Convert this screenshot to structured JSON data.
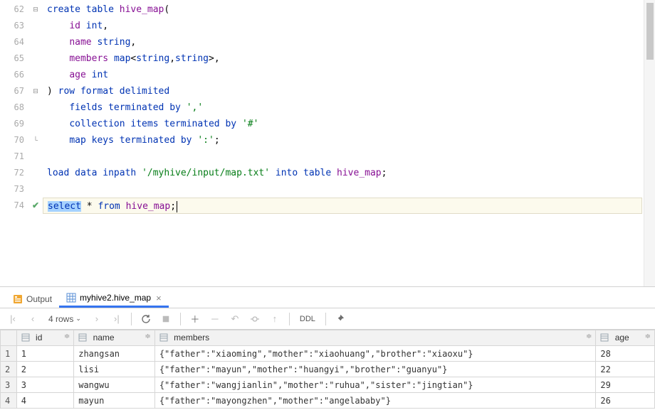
{
  "editor": {
    "lines": [
      {
        "n": 62,
        "fold": "open",
        "tokens": [
          [
            "kw",
            "create table"
          ],
          [
            "plain",
            " "
          ],
          [
            "ident",
            "hive_map"
          ],
          [
            "plain",
            "("
          ]
        ]
      },
      {
        "n": 63,
        "tokens": [
          [
            "plain",
            "    "
          ],
          [
            "ident",
            "id"
          ],
          [
            "plain",
            " "
          ],
          [
            "typ",
            "int"
          ],
          [
            "plain",
            ","
          ]
        ]
      },
      {
        "n": 64,
        "tokens": [
          [
            "plain",
            "    "
          ],
          [
            "ident",
            "name"
          ],
          [
            "plain",
            " "
          ],
          [
            "typ",
            "string"
          ],
          [
            "plain",
            ","
          ]
        ]
      },
      {
        "n": 65,
        "tokens": [
          [
            "plain",
            "    "
          ],
          [
            "ident",
            "members"
          ],
          [
            "plain",
            " "
          ],
          [
            "typ",
            "map"
          ],
          [
            "plain",
            "<"
          ],
          [
            "typ",
            "string"
          ],
          [
            "plain",
            ","
          ],
          [
            "typ",
            "string"
          ],
          [
            "plain",
            ">,"
          ]
        ]
      },
      {
        "n": 66,
        "tokens": [
          [
            "plain",
            "    "
          ],
          [
            "ident",
            "age"
          ],
          [
            "plain",
            " "
          ],
          [
            "typ",
            "int"
          ]
        ]
      },
      {
        "n": 67,
        "fold": "close",
        "tokens": [
          [
            "plain",
            ") "
          ],
          [
            "kw",
            "row format delimited"
          ]
        ]
      },
      {
        "n": 68,
        "tokens": [
          [
            "plain",
            "    "
          ],
          [
            "kw",
            "fields terminated by"
          ],
          [
            "plain",
            " "
          ],
          [
            "str",
            "','"
          ]
        ]
      },
      {
        "n": 69,
        "tokens": [
          [
            "plain",
            "    "
          ],
          [
            "kw",
            "collection items terminated by"
          ],
          [
            "plain",
            " "
          ],
          [
            "str",
            "'#'"
          ]
        ]
      },
      {
        "n": 70,
        "fold": "end",
        "tokens": [
          [
            "plain",
            "    "
          ],
          [
            "kw",
            "map keys terminated by"
          ],
          [
            "plain",
            " "
          ],
          [
            "str",
            "':'"
          ],
          [
            "plain",
            ";"
          ]
        ]
      },
      {
        "n": 71,
        "tokens": []
      },
      {
        "n": 72,
        "tokens": [
          [
            "kw",
            "load data inpath"
          ],
          [
            "plain",
            " "
          ],
          [
            "str",
            "'/myhive/input/map.txt'"
          ],
          [
            "plain",
            " "
          ],
          [
            "kw",
            "into table"
          ],
          [
            "plain",
            " "
          ],
          [
            "ident",
            "hive_map"
          ],
          [
            "plain",
            ";"
          ]
        ]
      },
      {
        "n": 73,
        "tokens": []
      },
      {
        "n": 74,
        "active": true,
        "check": true,
        "tokens": [
          [
            "kw",
            "select"
          ],
          [
            "plain",
            " * "
          ],
          [
            "kw",
            "from"
          ],
          [
            "plain",
            " "
          ],
          [
            "ident",
            "hive_map"
          ],
          [
            "plain",
            ";"
          ]
        ]
      }
    ]
  },
  "tabs": {
    "output_label": "Output",
    "result_label": "myhive2.hive_map"
  },
  "toolbar": {
    "rows_text": "4 rows",
    "ddl_label": "DDL"
  },
  "grid": {
    "columns": [
      "id",
      "name",
      "members",
      "age"
    ],
    "rows": [
      {
        "num": "1",
        "id": "1",
        "name": "zhangsan",
        "members": "{\"father\":\"xiaoming\",\"mother\":\"xiaohuang\",\"brother\":\"xiaoxu\"}",
        "age": "28"
      },
      {
        "num": "2",
        "id": "2",
        "name": "lisi",
        "members": "{\"father\":\"mayun\",\"mother\":\"huangyi\",\"brother\":\"guanyu\"}",
        "age": "22"
      },
      {
        "num": "3",
        "id": "3",
        "name": "wangwu",
        "members": "{\"father\":\"wangjianlin\",\"mother\":\"ruhua\",\"sister\":\"jingtian\"}",
        "age": "29"
      },
      {
        "num": "4",
        "id": "4",
        "name": "mayun",
        "members": "{\"father\":\"mayongzhen\",\"mother\":\"angelababy\"}",
        "age": "26"
      }
    ]
  }
}
